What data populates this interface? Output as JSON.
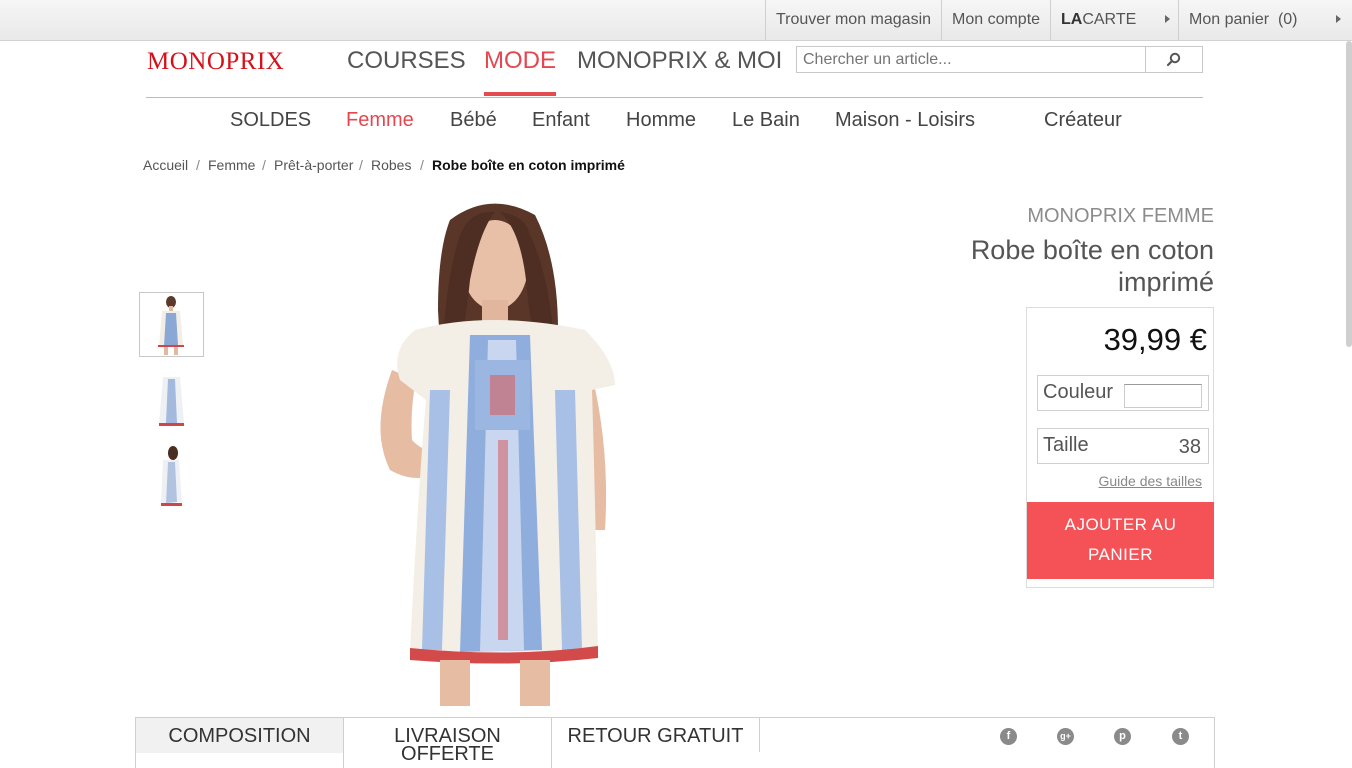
{
  "topbar": {
    "store_finder": "Trouver mon magasin",
    "account": "Mon compte",
    "carte_bold": "LA",
    "carte_rest": "CARTE",
    "cart": "Mon panier",
    "cart_count": "(0)"
  },
  "header": {
    "logo": "MONOPRIX",
    "nav": [
      "COURSES",
      "MODE",
      "MONOPRIX & MOI"
    ],
    "active_nav": "MODE",
    "search_placeholder": "Chercher un article..."
  },
  "category_nav": [
    "SOLDES",
    "Femme",
    "Bébé",
    "Enfant",
    "Homme",
    "Le Bain",
    "Maison - Loisirs",
    "Créateur"
  ],
  "breadcrumb": [
    "Accueil",
    "Femme",
    "Prêt-à-porter",
    "Robes",
    "Robe boîte en coton imprimé"
  ],
  "product": {
    "brand": "MONOPRIX FEMME",
    "title": "Robe boîte en coton imprimé",
    "price": "39,99 €",
    "color_label": "Couleur",
    "size_label": "Taille",
    "size_value": "38",
    "size_guide": "Guide des tailles",
    "add_to_cart_line1": "AJOUTER AU",
    "add_to_cart_line2": "PANIER"
  },
  "tabs": {
    "composition": "COMPOSITION",
    "delivery_line1": "LIVRAISON",
    "delivery_line2": "OFFERTE",
    "returns": "RETOUR GRATUIT"
  },
  "social_icons": [
    "facebook-icon",
    "google-plus-icon",
    "pinterest-icon",
    "twitter-icon"
  ],
  "colors": {
    "brand_red": "#d6111a",
    "accent": "#e5474f",
    "button": "#f45256"
  }
}
